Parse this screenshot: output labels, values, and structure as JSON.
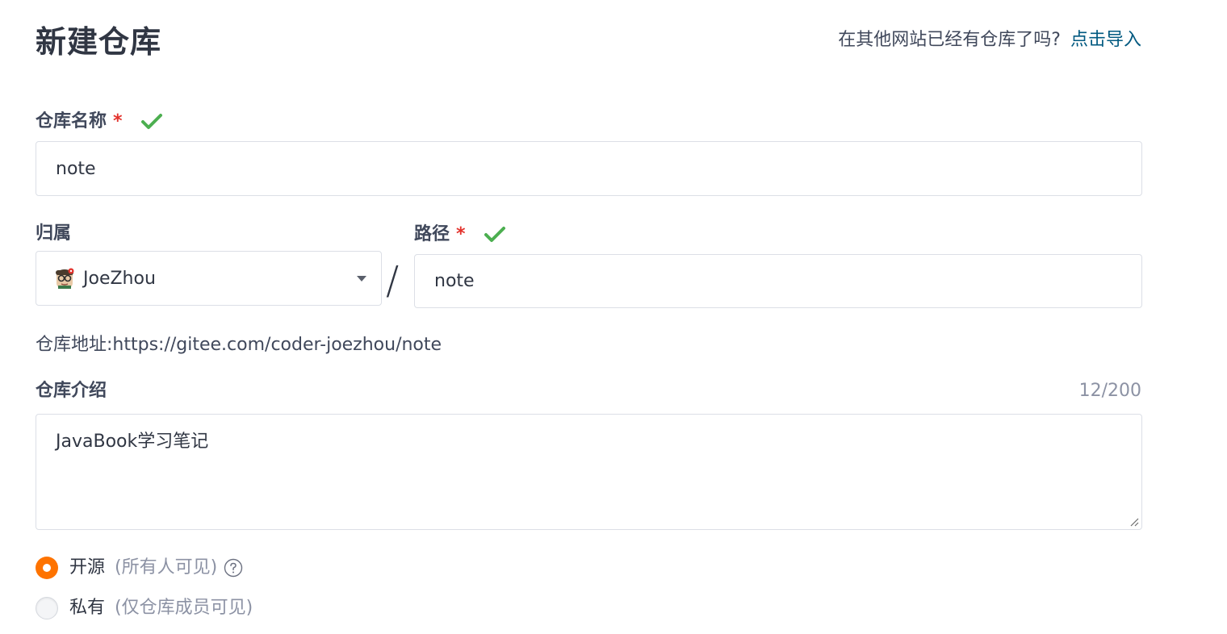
{
  "page": {
    "title": "新建仓库",
    "import_prompt": "在其他网站已经有仓库了吗?",
    "import_link": "点击导入"
  },
  "repo_name": {
    "label": "仓库名称",
    "required_mark": "*",
    "value": "note"
  },
  "owner": {
    "label": "归属",
    "selected": "JoeZhou"
  },
  "separator": "/",
  "path": {
    "label": "路径",
    "required_mark": "*",
    "value": "note"
  },
  "repo_url": {
    "label": "仓库地址:",
    "value": "https://gitee.com/coder-joezhou/note"
  },
  "description": {
    "label": "仓库介绍",
    "counter": "12/200",
    "value": "JavaBook学习笔记"
  },
  "visibility": {
    "options": [
      {
        "label": "开源",
        "hint": "(所有人可见)",
        "checked": true
      },
      {
        "label": "私有",
        "hint": "(仅仓库成员可见)",
        "checked": false
      }
    ]
  },
  "colors": {
    "accent_orange": "#fe7300",
    "link_blue": "#005980",
    "required_red": "#e3322c",
    "valid_green": "#4caf50"
  },
  "icons": {
    "valid": "check-icon",
    "dropdown": "caret-down-icon",
    "help": "question-circle-icon",
    "avatar": "user-avatar"
  }
}
